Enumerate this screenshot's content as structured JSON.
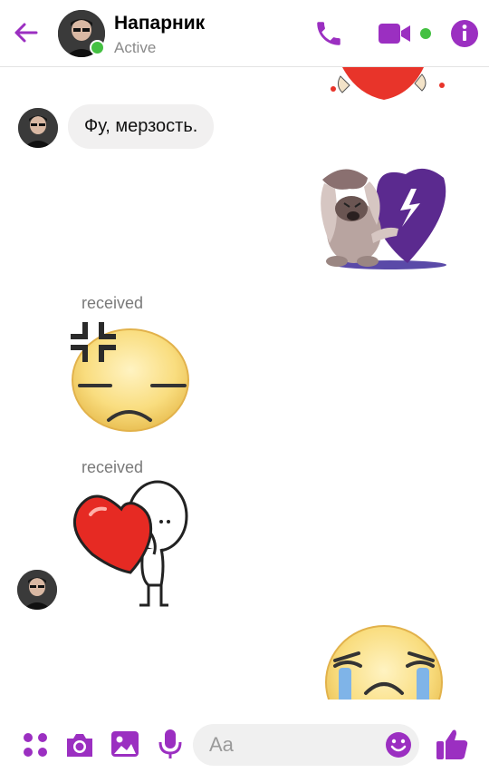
{
  "header": {
    "contact_name": "Напарник",
    "status": "Active",
    "back_icon": "arrow-left-icon",
    "call_icon": "phone-icon",
    "video_icon": "video-camera-icon",
    "info_icon": "info-icon"
  },
  "messages": {
    "text_message": "Фу, мерзость.",
    "received_label_1": "received",
    "received_label_2": "received"
  },
  "composer": {
    "placeholder": "Aa",
    "icons": [
      "grid-dots-icon",
      "camera-icon",
      "image-icon",
      "microphone-icon",
      "smiley-icon",
      "thumbs-up-icon"
    ]
  },
  "colors": {
    "accent": "#9b2fc1",
    "online": "#44c042",
    "bubble_bg": "#f1f0f0"
  }
}
